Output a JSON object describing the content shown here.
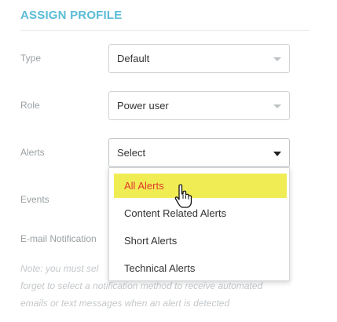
{
  "section": {
    "title": "ASSIGN PROFILE"
  },
  "fields": {
    "type": {
      "label": "Type",
      "value": "Default"
    },
    "role": {
      "label": "Role",
      "value": "Power user"
    },
    "alerts": {
      "label": "Alerts",
      "value": "Select"
    },
    "events": {
      "label": "Events"
    },
    "email": {
      "label": "E-mail Notification"
    }
  },
  "alerts_dropdown": {
    "options": [
      "All Alerts",
      "Content Related Alerts",
      "Short Alerts",
      "Technical Alerts"
    ],
    "highlighted": "All Alerts"
  },
  "note": {
    "line1": "Note: you must sel",
    "line2": "forget to select a notification method to receive automated",
    "line3": "emails or text messages when an alert is detected"
  },
  "colors": {
    "title": "#5bbcd6",
    "highlight_bg": "#f0ec54",
    "highlight_text": "#e0392b",
    "label": "#9aa0a4"
  },
  "icons": {
    "caret": "chevron-down-icon",
    "cursor": "hand-pointer-icon"
  }
}
